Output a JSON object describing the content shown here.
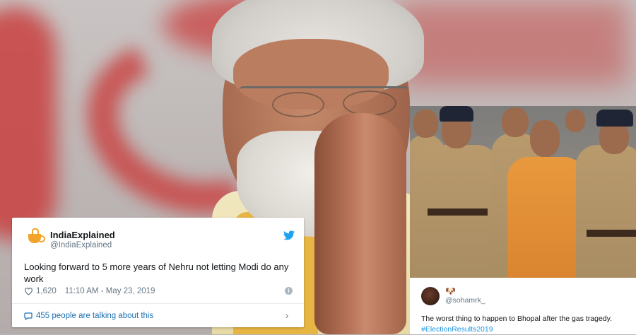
{
  "tweet1": {
    "display_name": "IndiaExplained",
    "handle": "@IndiaExplained",
    "text": "Looking forward to 5 more years of Nehru not letting Modi do any work",
    "likes": "1,620",
    "timestamp": "11:10 AM - May 23, 2019",
    "talking": "455 people are talking about this",
    "info_label": "i",
    "chevron": "›"
  },
  "tweet2": {
    "display_name": "🐶",
    "handle": "@sohamrk_",
    "text": "The worst thing to happen to Bhopal after the gas tragedy.",
    "hashtag": "#ElectionResults2019"
  },
  "colors": {
    "twitter_blue": "#1da1f2",
    "link_blue": "#1b95e0",
    "muted_gray": "#657786",
    "card_white": "#ffffff"
  },
  "icons": {
    "bird": "twitter-bird-icon",
    "heart": "heart-icon",
    "info": "info-icon",
    "bubble": "speech-bubble-icon",
    "chevron": "chevron-right-icon"
  }
}
